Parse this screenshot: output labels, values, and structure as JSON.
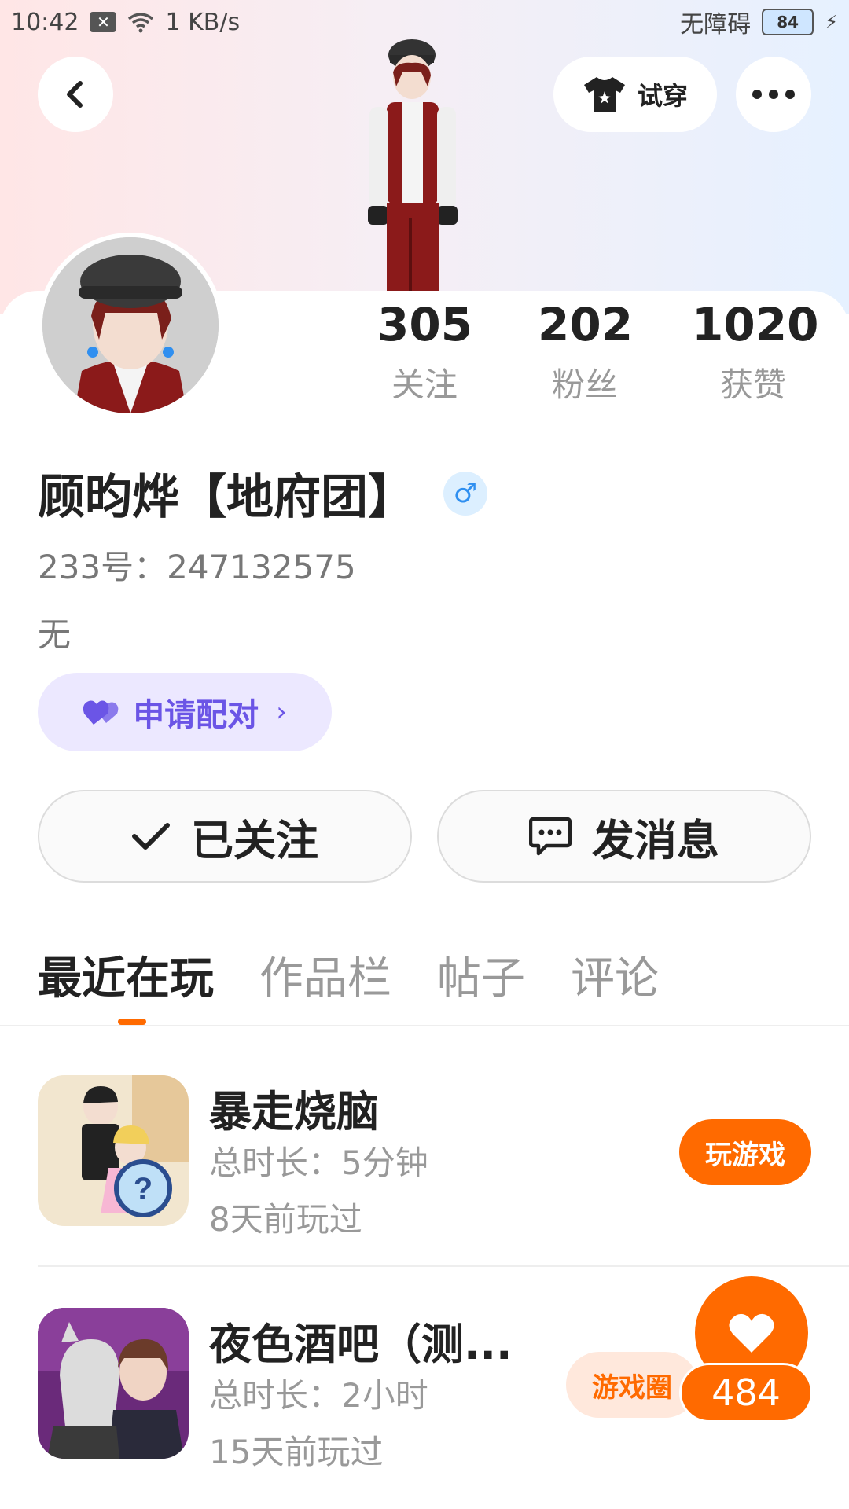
{
  "status_bar": {
    "time": "10:42",
    "net_speed": "1 KB/s",
    "accessibility": "无障碍",
    "battery": "84"
  },
  "header": {
    "tryon_label": "试穿"
  },
  "profile": {
    "stats": [
      {
        "value": "305",
        "label": "关注"
      },
      {
        "value": "202",
        "label": "粉丝"
      },
      {
        "value": "1020",
        "label": "获赞"
      }
    ],
    "name": "顾昀烨【地府团】",
    "gender_symbol": "♂",
    "uid": "233号：247132575",
    "bio": "无",
    "pair_button": "申请配对",
    "follow_button": "已关注",
    "message_button": "发消息"
  },
  "tabs": [
    "最近在玩",
    "作品栏",
    "帖子",
    "评论"
  ],
  "games": [
    {
      "title": "暴走烧脑",
      "duration": "总时长：5分钟",
      "last_played": "8天前玩过",
      "action": "玩游戏"
    },
    {
      "title": "夜色酒吧（测...",
      "duration": "总时长：2小时",
      "last_played": "15天前玩过",
      "action": "游戏圈"
    }
  ],
  "like_count": "484",
  "colors": {
    "accent": "#ff6a00",
    "pair": "#6b55e6",
    "gender": "#2f8ff0"
  }
}
